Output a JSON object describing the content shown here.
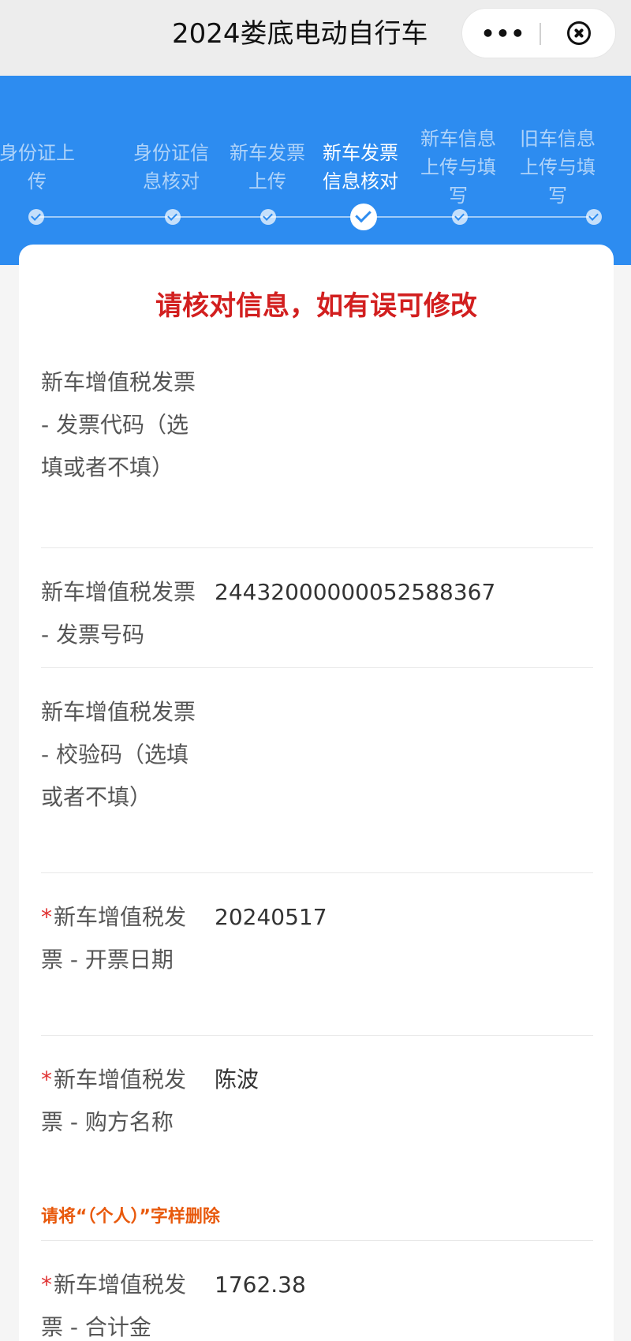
{
  "header": {
    "title": "2024娄底电动自行车",
    "more_icon": "more-dots-icon",
    "close_icon": "close-circle-icon"
  },
  "steps": [
    {
      "label": "身份证上传",
      "active": false
    },
    {
      "label": "身份证信息核对",
      "active": false
    },
    {
      "label": "新车发票上传",
      "active": false
    },
    {
      "label": "新车发票信息核对",
      "active": true
    },
    {
      "label": "新车信息上传与填写",
      "active": false
    },
    {
      "label": "旧车信息上传与填写",
      "active": false
    }
  ],
  "notice": "请核对信息，如有误可修改",
  "fields": [
    {
      "required": false,
      "label": "新车增值税发票 - 发票代码（选填或者不填）",
      "value": ""
    },
    {
      "required": false,
      "label": "新车增值税发票 - 发票号码",
      "value": "24432000000052588367"
    },
    {
      "required": false,
      "label": "新车增值税发票 - 校验码（选填或者不填）",
      "value": ""
    },
    {
      "required": true,
      "label": "新车增值税发票 - 开票日期",
      "value": "20240517"
    },
    {
      "required": true,
      "label": "新车增值税发票 - 购方名称",
      "value": "陈波",
      "hint": "请将“（个人）”字样删除"
    },
    {
      "required": true,
      "label": "新车增值税发票 - 合计金",
      "value": "1762.38"
    }
  ],
  "colors": {
    "primary": "#2d8cf0",
    "notice": "#d21f1f",
    "hint": "#e8590c",
    "required": "#e03131"
  }
}
